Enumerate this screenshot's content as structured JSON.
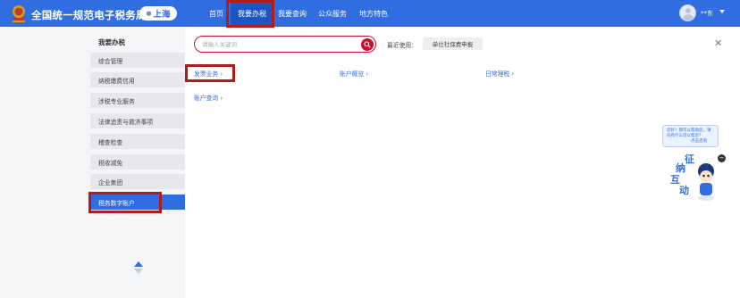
{
  "header": {
    "site_title": "全国统一规范电子税务局",
    "region": "上海",
    "nav": [
      "首页",
      "我要办税",
      "我要查询",
      "公众服务",
      "地方特色"
    ],
    "active_nav": "我要办税",
    "username": "**东"
  },
  "sidebar": {
    "title": "我要办税",
    "items": [
      "综合管理",
      "纳税缴费信用",
      "涉税专业服务",
      "法律追责与救济事项",
      "稽查检查",
      "税收减免",
      "企业集团",
      "税务数字账户"
    ],
    "active_item": "税务数字账户"
  },
  "search": {
    "placeholder": "请输入关键词",
    "recent_label": "最近使用：",
    "recent_items": [
      "单位社保费申报"
    ]
  },
  "categories": [
    "发票业务",
    "账户概览",
    "日常理税",
    "账户查询"
  ],
  "assistant": {
    "bubble_text": "您好！我可以帮助您，请问有什么可以帮您？",
    "bubble_link": "点击咨询",
    "chars": [
      "征",
      "纳",
      "互",
      "动"
    ]
  },
  "colors": {
    "primary": "#2f6de0",
    "highlight_box": "#b31b1b",
    "search_red": "#c8102e"
  }
}
